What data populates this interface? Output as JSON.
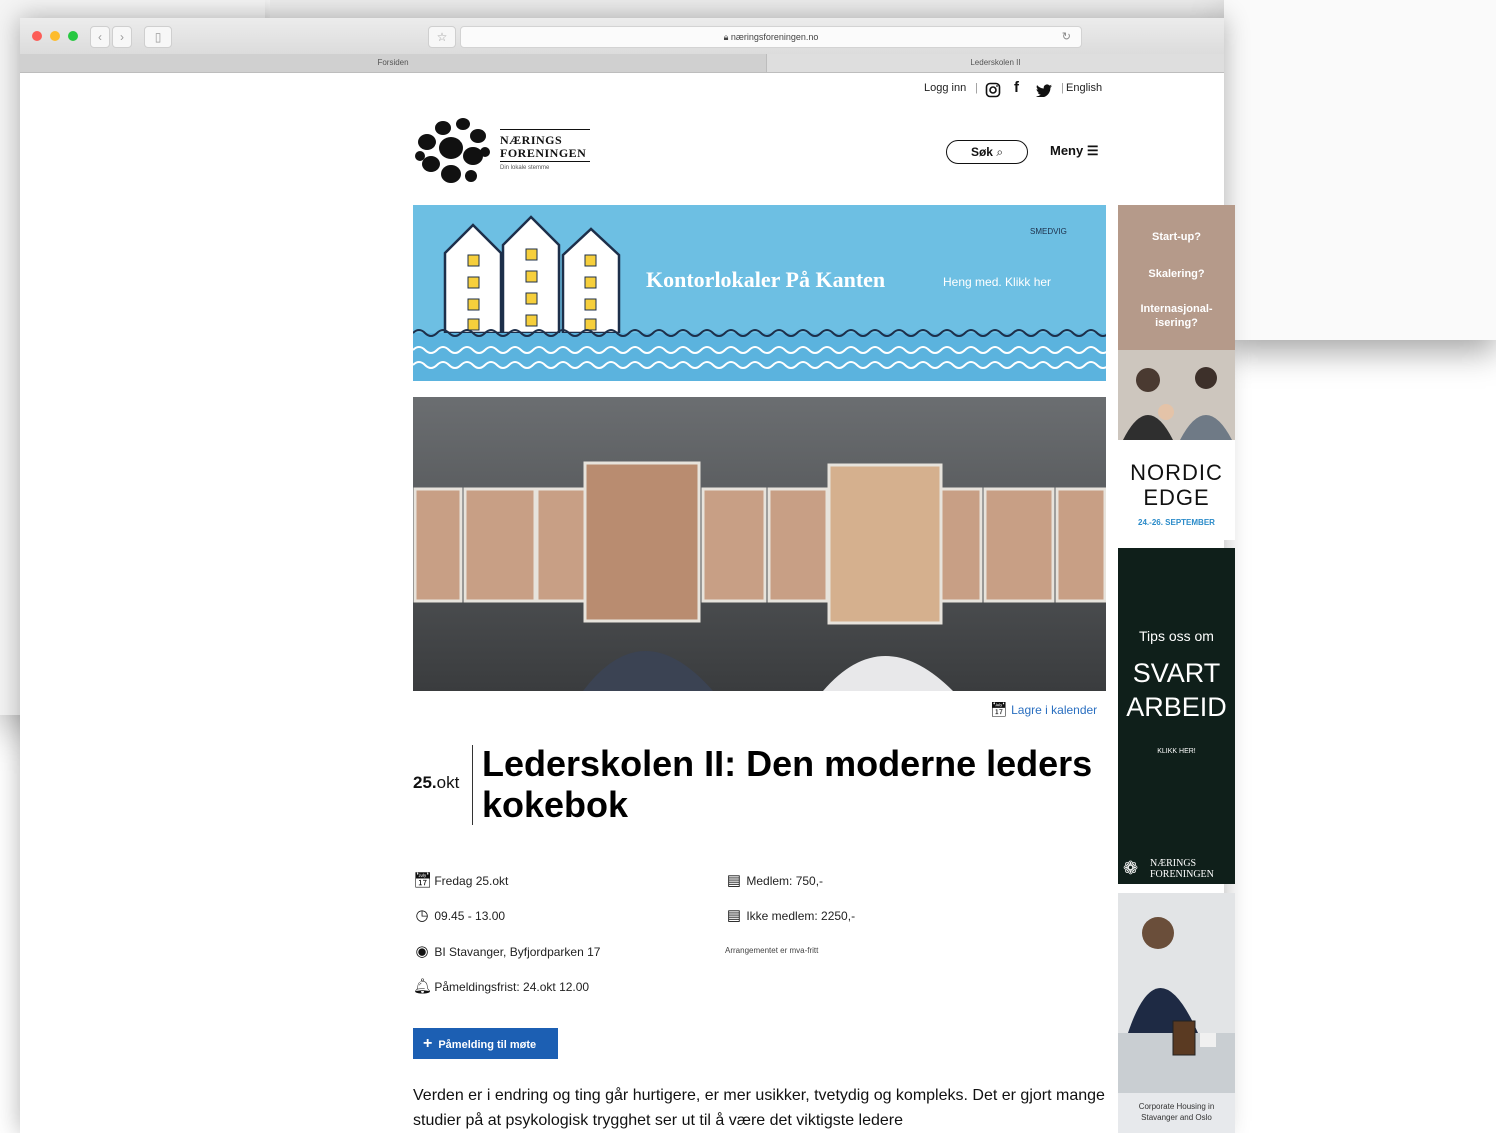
{
  "browser": {
    "url": "næringsforeningen.no",
    "tabs": [
      "Forsiden",
      "Lederskolen II"
    ]
  },
  "utility": {
    "login": "Logg inn",
    "separator": "|",
    "language": "English"
  },
  "logo": {
    "line1": "NÆRINGS",
    "line2": "FORENINGEN",
    "tagline": "Din lokale stemme"
  },
  "header": {
    "search_label": "Søk",
    "menu_label": "Meny"
  },
  "banner": {
    "brand": "SMEDVIG",
    "headline": "Kontorlokaler På Kanten",
    "cta": "Heng med. Klikk her"
  },
  "event": {
    "save_calendar": "Lagre i kalender",
    "date_day": "25.",
    "date_month": "okt",
    "title": "Lederskolen II: Den moderne leders kokebok",
    "details_left": [
      {
        "icon": "calendar-icon",
        "text": "Fredag 25.okt"
      },
      {
        "icon": "clock-icon",
        "text": "09.45 - 13.00"
      },
      {
        "icon": "location-icon",
        "text": "BI Stavanger, Byfjordparken 17"
      },
      {
        "icon": "alarm-icon",
        "text": "Påmeldingsfrist: 24.okt 12.00"
      }
    ],
    "details_right": [
      {
        "icon": "card-icon",
        "text": "Medlem: 750,-"
      },
      {
        "icon": "card-icon",
        "text": "Ikke medlem: 2250,-"
      }
    ],
    "note": "Arrangementet er mva-fritt",
    "cta_label": "Påmelding til møte",
    "body": "Verden er i endring og ting går hurtigere, er mer usikker, tvetydig og kompleks. Det er gjort mange studier på at psykologisk trygghet ser ut til å være det viktigste ledere"
  },
  "side_ads": {
    "ad1": {
      "lines": [
        "Start-up?",
        "Skalering?",
        "Internasjonal-isering?"
      ],
      "brand_line1": "NORDIC",
      "brand_line2": "EDGE",
      "dates": "24.-26. SEPTEMBER"
    },
    "ad2": {
      "line1": "Tips oss om",
      "line2": "SVART",
      "line3": "ARBEID",
      "cta": "KLIKK HER!",
      "logo_line1": "NÆRINGS",
      "logo_line2": "FORENINGEN"
    },
    "ad3": {
      "caption": "Corporate Housing in Stavanger and Oslo"
    }
  }
}
